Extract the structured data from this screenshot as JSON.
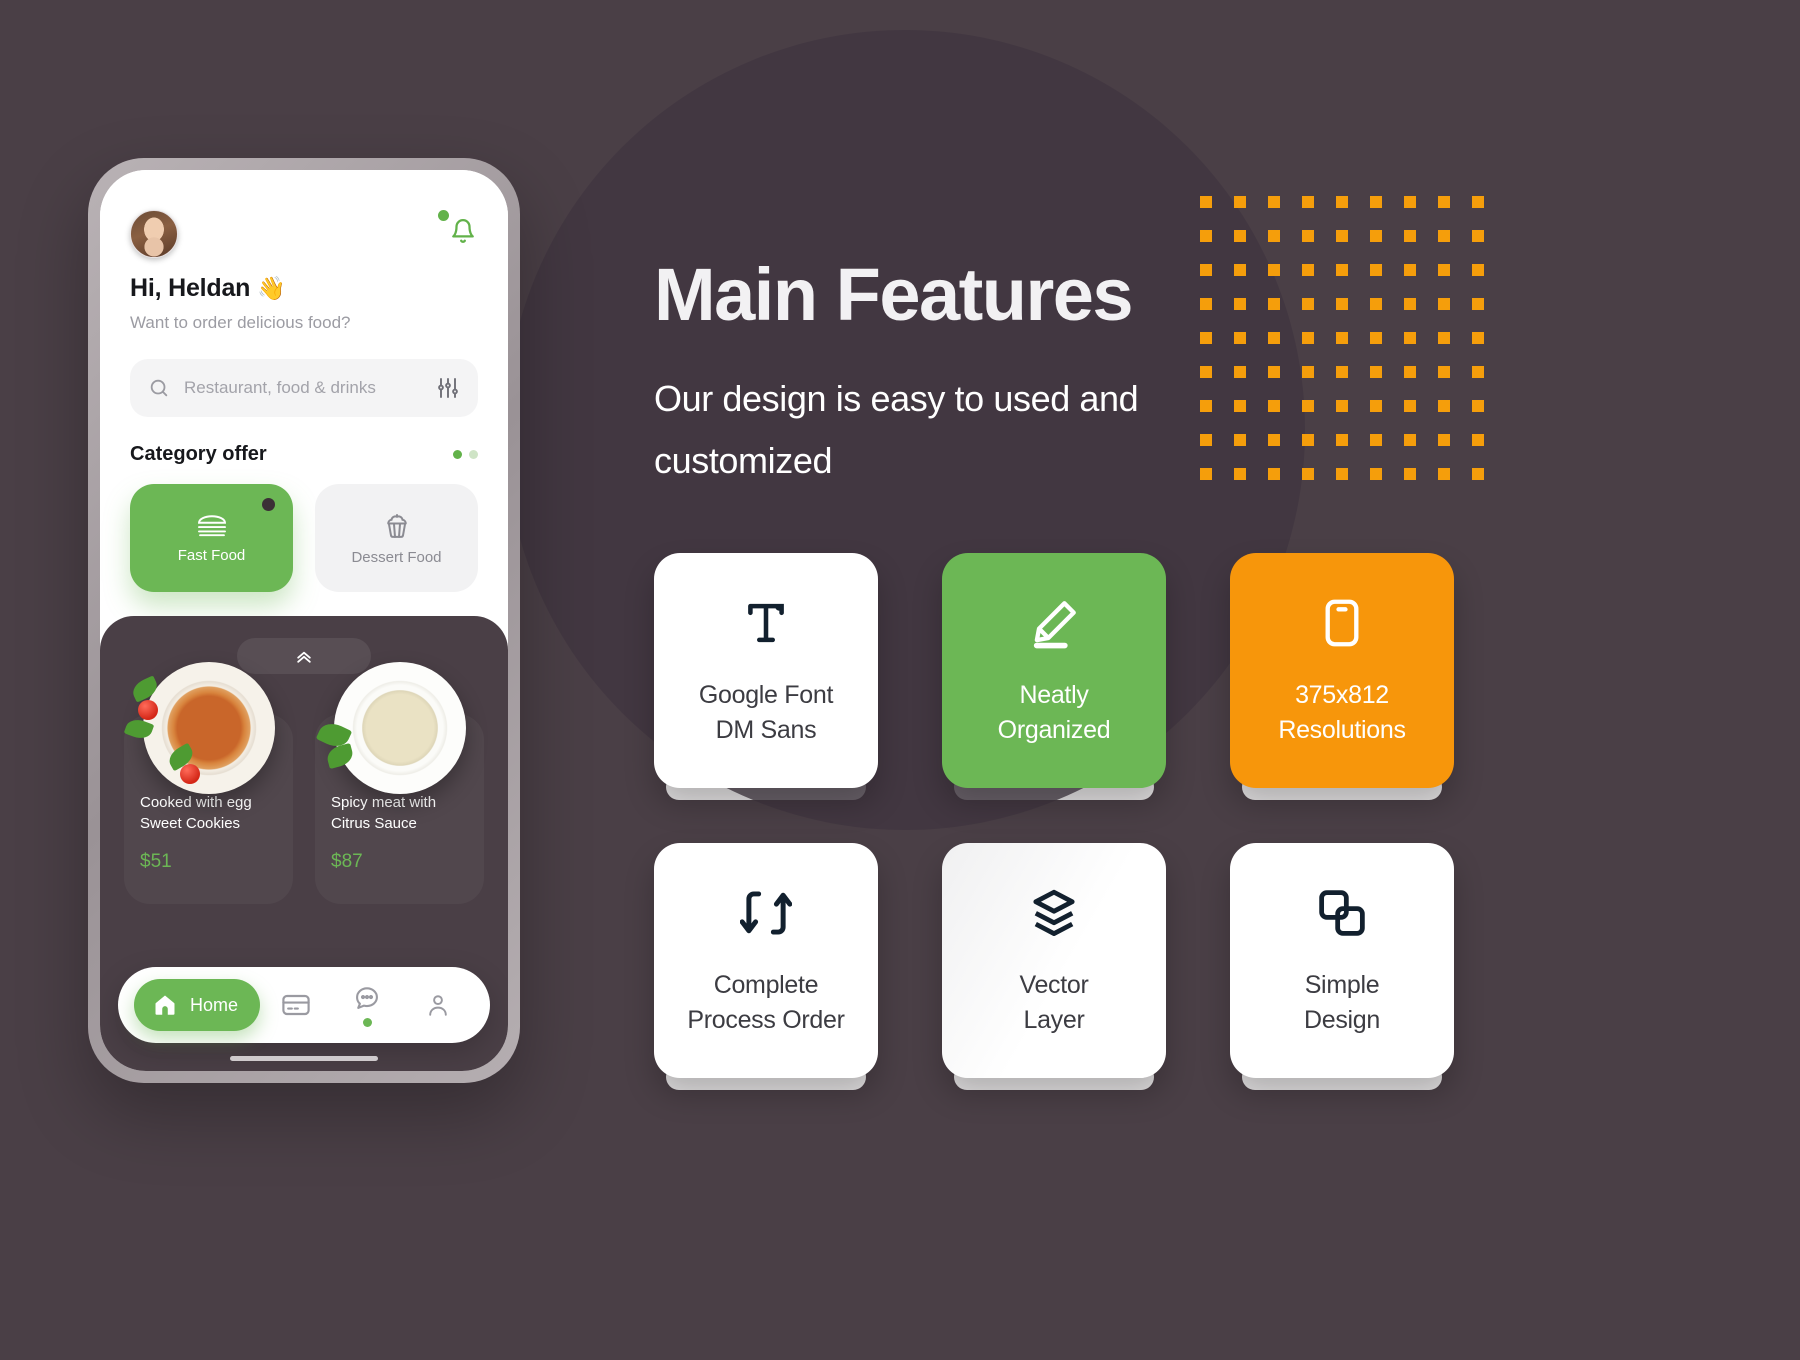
{
  "page": {
    "background_color": "#4a3f46",
    "accent_green": "#6CB755",
    "accent_orange": "#F7960B",
    "dot_color": "#F59E0B"
  },
  "phone": {
    "header": {
      "avatar": "user-avatar",
      "notification_icon": "bell-icon",
      "greeting": "Hi, Heldan",
      "greeting_emoji": "👋",
      "subgreeting": "Want to order delicious food?"
    },
    "search": {
      "placeholder": "Restaurant, food & drinks",
      "search_icon": "search-icon",
      "filter_icon": "sliders-icon"
    },
    "category": {
      "title": "Category offer",
      "items": [
        {
          "label": "Fast Food",
          "icon": "burger-icon",
          "active": true
        },
        {
          "label": "Dessert Food",
          "icon": "cupcake-icon",
          "active": false
        }
      ]
    },
    "food_panel": {
      "grabber_icon": "chevrons-up-icon",
      "items": [
        {
          "name": "Cooked with egg\nSweet Cookies",
          "name_line1": "Cooked with egg",
          "name_line2": "Sweet Cookies",
          "price": "$51",
          "image": "pasta-bolognese-plate"
        },
        {
          "name": "Spicy meat with\nCitrus Sauce",
          "name_line1": "Spicy meat with",
          "name_line2": "Citrus Sauce",
          "price": "$87",
          "image": "tortellini-cream-plate"
        }
      ]
    },
    "bottom_nav": {
      "items": [
        {
          "label": "Home",
          "icon": "home-icon",
          "active": true
        },
        {
          "label": "",
          "icon": "card-icon",
          "active": false
        },
        {
          "label": "",
          "icon": "chat-bubble-icon",
          "active": false,
          "has_dot": true
        },
        {
          "label": "",
          "icon": "person-icon",
          "active": false
        }
      ]
    }
  },
  "content": {
    "headline": "Main Features",
    "subhead": "Our design is easy to used and customized",
    "features": [
      {
        "line1": "Google Font",
        "line2": "DM Sans",
        "icon": "text-t-icon",
        "style": "white"
      },
      {
        "line1": "Neatly",
        "line2": "Organized",
        "icon": "pencil-edit-icon",
        "style": "green"
      },
      {
        "line1": "375x812",
        "line2": "Resolutions",
        "icon": "mobile-icon",
        "style": "orange"
      },
      {
        "line1": "Complete",
        "line2": "Process Order",
        "icon": "swap-arrows-icon",
        "style": "white"
      },
      {
        "line1": "Vector",
        "line2": "Layer",
        "icon": "layers-icon",
        "style": "whiteg"
      },
      {
        "line1": "Simple",
        "line2": "Design",
        "icon": "copy-shapes-icon",
        "style": "white"
      }
    ]
  }
}
